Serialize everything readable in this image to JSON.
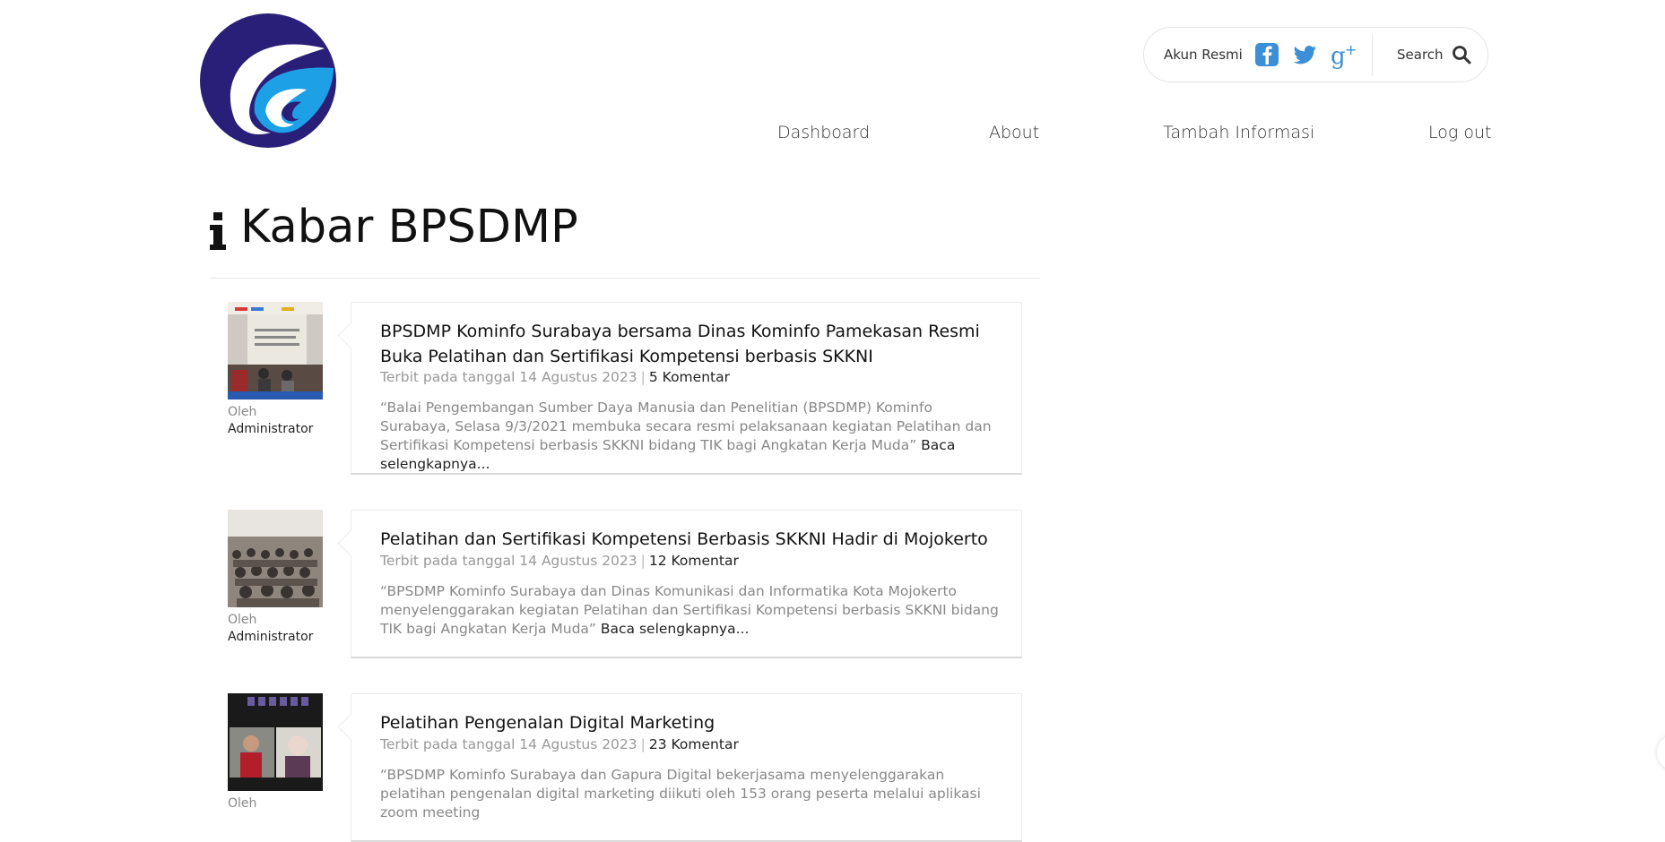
{
  "header": {
    "akun_label": "Akun Resmi",
    "search_label": "Search",
    "social": [
      {
        "name": "facebook-icon",
        "color": "#3b8fd6"
      },
      {
        "name": "twitter-icon",
        "color": "#3b8fd6"
      },
      {
        "name": "google-plus-icon",
        "color": "#3b8fd6"
      }
    ]
  },
  "nav": [
    {
      "label": "Dashboard"
    },
    {
      "label": "About"
    },
    {
      "label": "Tambah Informasi"
    },
    {
      "label": "Log out"
    }
  ],
  "page": {
    "title": "Kabar BPSDMP",
    "title_icon": "info-icon"
  },
  "posts": [
    {
      "title": "BPSDMP Kominfo Surabaya bersama Dinas Kominfo Pamekasan Resmi Buka Pelatihan dan Sertifikasi Kompetensi berbasis SKKNI",
      "date_text": "Terbit pada tanggal 14 Agustus 2023",
      "comments": "5 Komentar",
      "excerpt": "“Balai Pengembangan Sumber Daya Manusia dan Penelitian (BPSDMP) Kominfo Surabaya, Selasa 9/3/2021 membuka secara resmi pelaksanaan kegiatan Pelatihan dan Sertifikasi Kompetensi berbasis SKKNI bidang TIK bagi Angkatan Kerja Muda”",
      "read_more": "Baca selengkapnya...",
      "author_prefix": "Oleh",
      "author": "Administrator"
    },
    {
      "title": "Pelatihan dan Sertifikasi Kompetensi Berbasis SKKNI Hadir di Mojokerto",
      "date_text": "Terbit pada tanggal 14 Agustus 2023",
      "comments": "12 Komentar",
      "excerpt": "“BPSDMP Kominfo Surabaya dan Dinas Komunikasi dan Informatika Kota Mojokerto menyelenggarakan kegiatan Pelatihan dan Sertifikasi Kompetensi berbasis SKKNI bidang TIK bagi Angkatan Kerja Muda”",
      "read_more": "Baca selengkapnya...",
      "author_prefix": "Oleh",
      "author": "Administrator"
    },
    {
      "title": "Pelatihan Pengenalan Digital Marketing",
      "date_text": "Terbit pada tanggal 14 Agustus 2023",
      "comments": "23 Komentar",
      "excerpt": "“BPSDMP Kominfo Surabaya dan Gapura Digital bekerjasama menyelenggarakan pelatihan pengenalan digital marketing diikuti oleh 153 orang peserta melalui aplikasi zoom meeting",
      "read_more": "",
      "author_prefix": "Oleh",
      "author": ""
    }
  ]
}
